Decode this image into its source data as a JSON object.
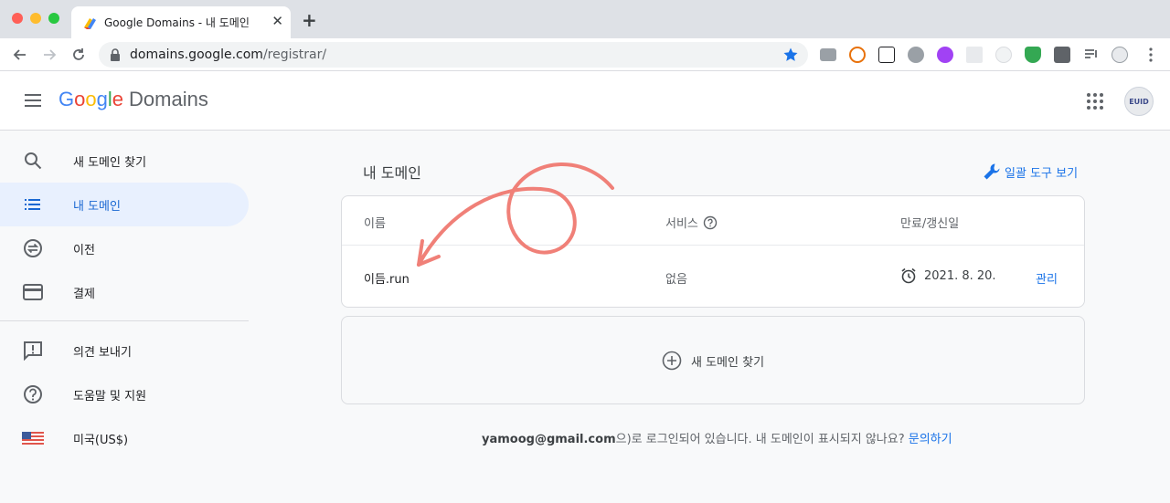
{
  "browser": {
    "tab_title": "Google Domains - 내 도메인",
    "url_host": "domains.google.com",
    "url_path": "/registrar/"
  },
  "app": {
    "logo_parts": [
      "G",
      "o",
      "o",
      "g",
      "l",
      "e"
    ],
    "product": "Domains",
    "avatar_text": "EUID"
  },
  "sidebar": {
    "items": [
      {
        "label": "새 도메인 찾기",
        "icon": "search-icon"
      },
      {
        "label": "내 도메인",
        "icon": "list-icon",
        "active": true
      },
      {
        "label": "이전",
        "icon": "transfer-icon"
      },
      {
        "label": "결제",
        "icon": "credit-card-icon"
      },
      {
        "label": "의견 보내기",
        "icon": "feedback-icon"
      },
      {
        "label": "도움말 및 지원",
        "icon": "help-icon"
      },
      {
        "label": "미국(US$)",
        "icon": "us-flag-icon"
      }
    ]
  },
  "main": {
    "title": "내 도메인",
    "bulk_tools": "일괄 도구 보기",
    "columns": {
      "name": "이름",
      "service": "서비스",
      "expiry": "만료/갱신일"
    },
    "rows": [
      {
        "name": "이듬.run",
        "service": "없음",
        "expiry": "2021. 8. 20.",
        "action": "관리"
      }
    ],
    "add_domain": "새 도메인 찾기",
    "footer": {
      "email": "yamoog@gmail.com",
      "text": "으)로 로그인되어 있습니다. 내 도메인이 표시되지 않나요?",
      "contact": "문의하기"
    }
  },
  "colors": {
    "accent": "#1a73e8",
    "active_bg": "#e8f0fe",
    "annotation": "#f08078"
  }
}
